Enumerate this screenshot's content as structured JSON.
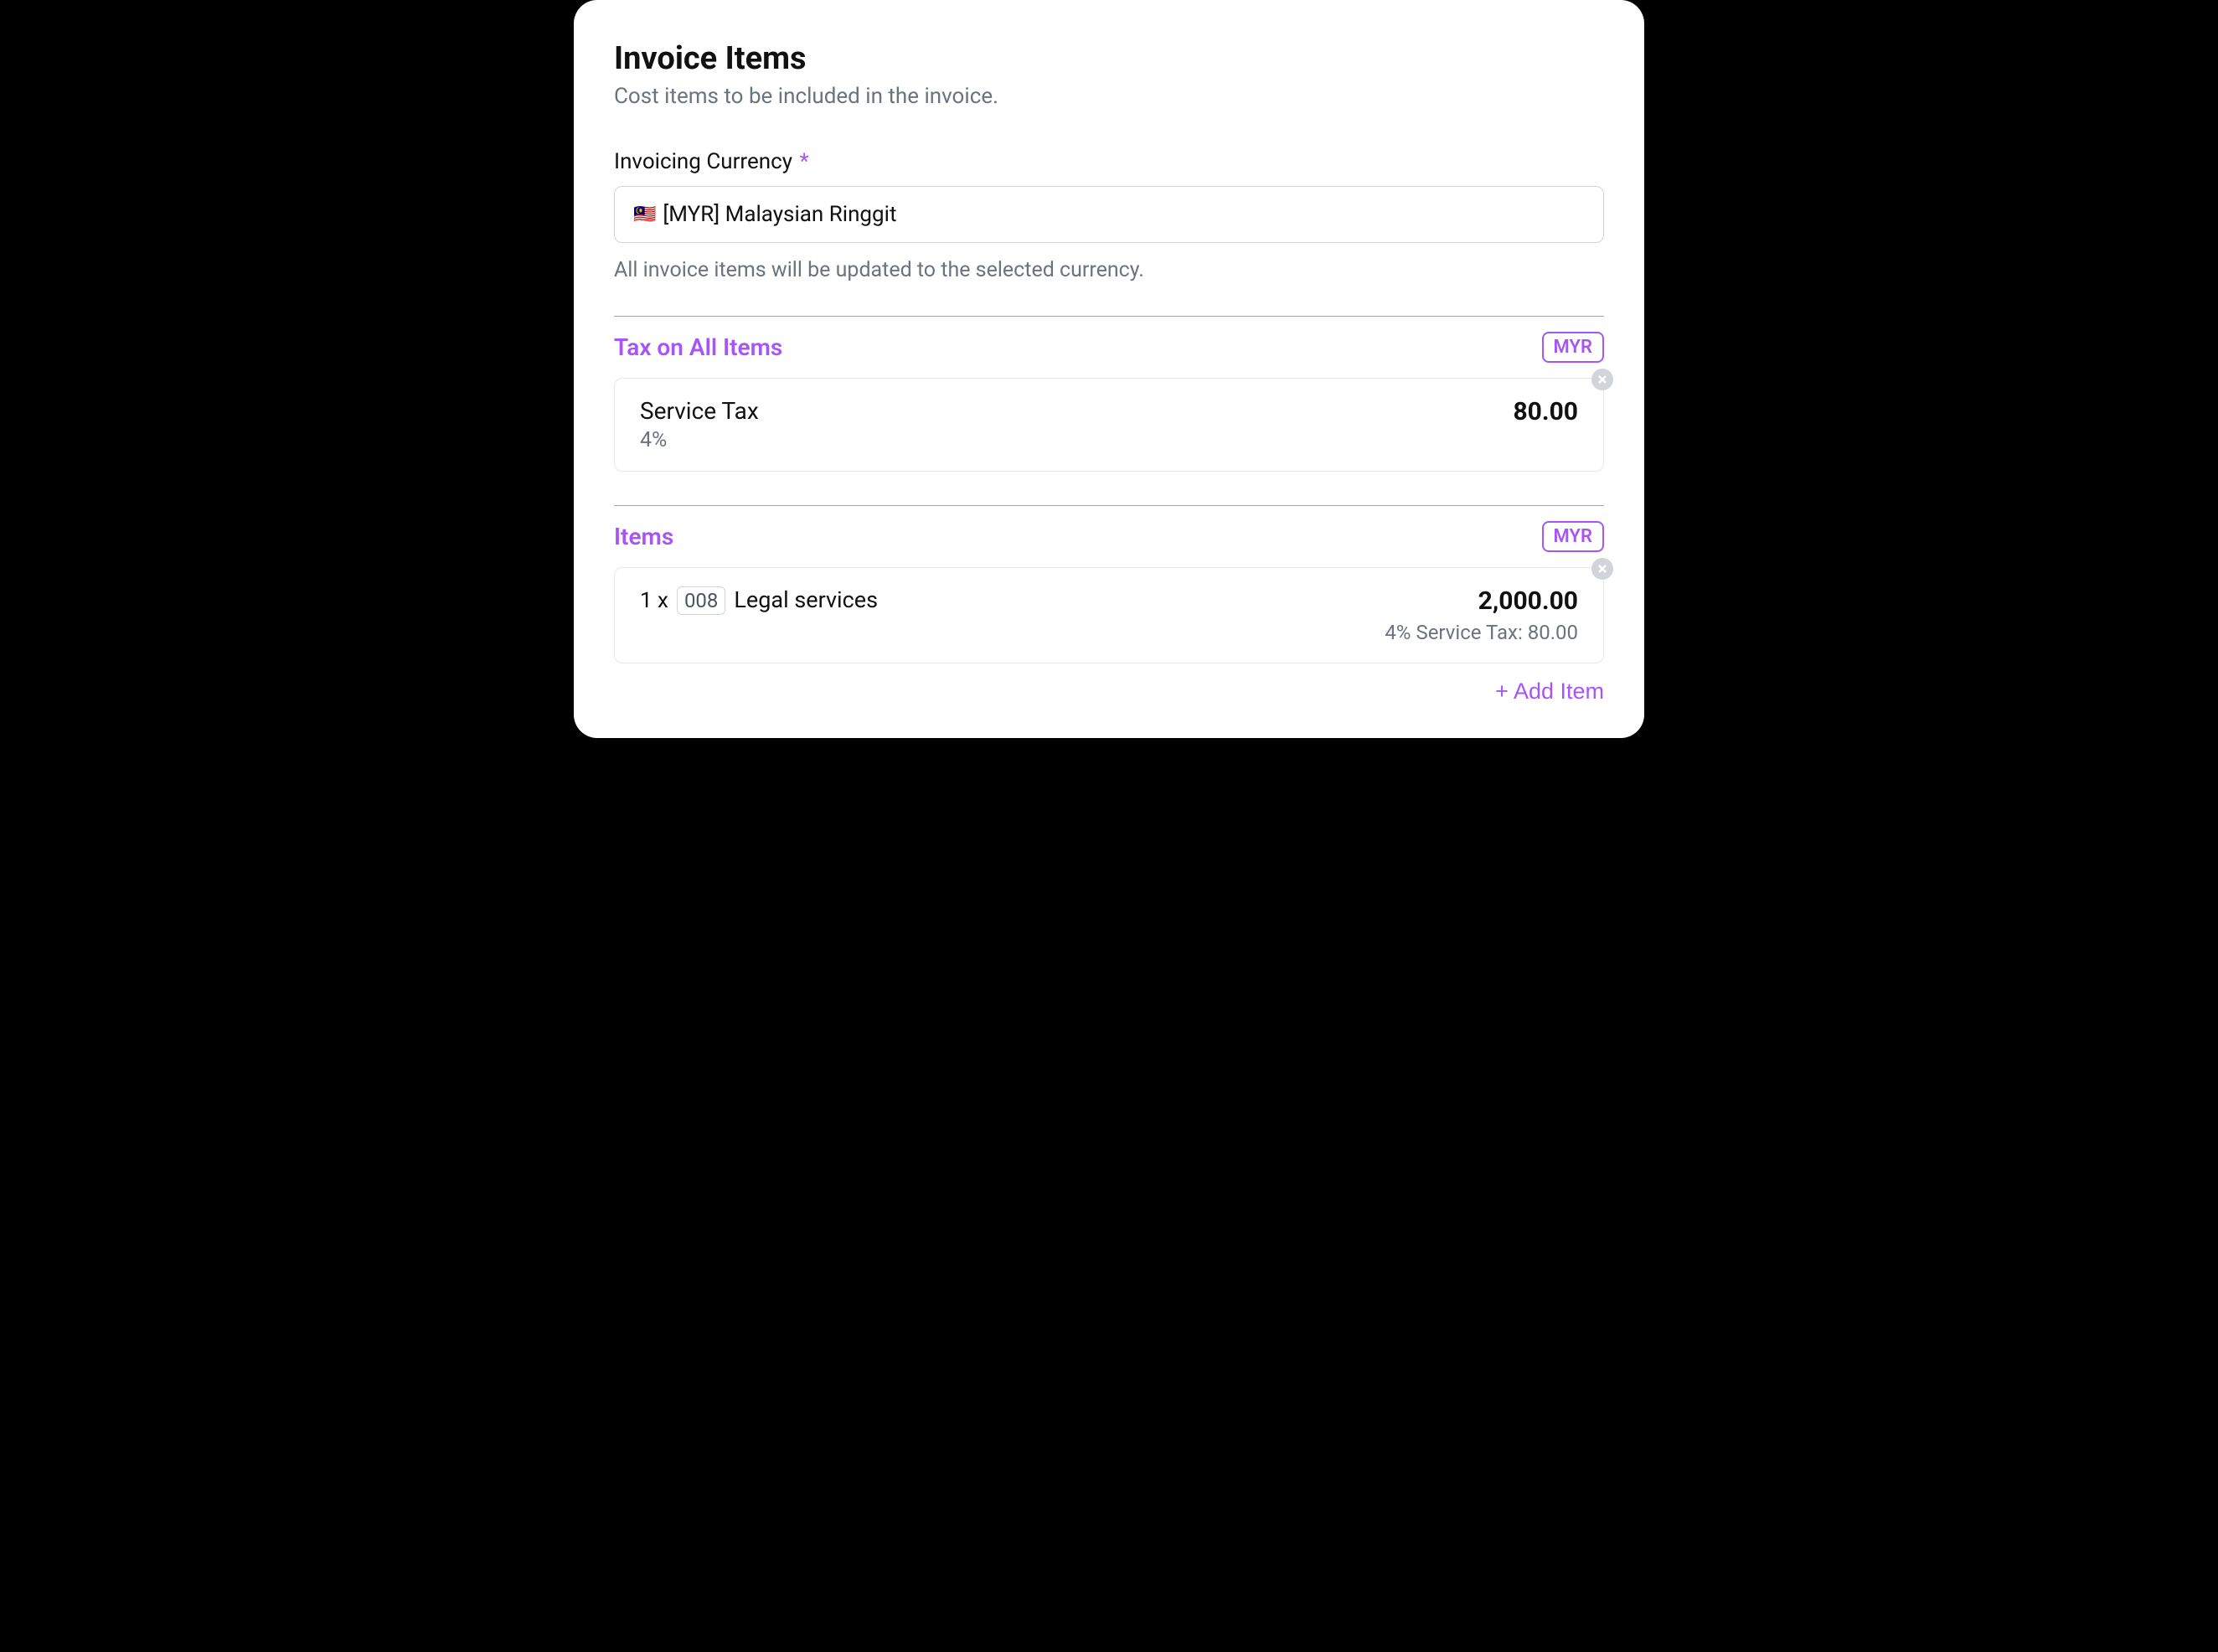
{
  "header": {
    "title": "Invoice Items",
    "subtitle": "Cost items to be included in the invoice."
  },
  "currency_field": {
    "label": "Invoicing Currency",
    "required_marker": "*",
    "flag": "🇲🇾",
    "value": "[MYR] Malaysian Ringgit",
    "help": "All invoice items will be updated to the selected currency."
  },
  "tax_section": {
    "title": "Tax on All Items",
    "currency_badge": "MYR",
    "tax": {
      "name": "Service Tax",
      "rate": "4%",
      "amount": "80.00"
    }
  },
  "items_section": {
    "title": "Items",
    "currency_badge": "MYR",
    "rows": [
      {
        "qty_prefix": "1 x",
        "code": "008",
        "description": "Legal services",
        "amount": "2,000.00",
        "tax_line": "4% Service Tax: 80.00"
      }
    ],
    "add_button": "Add Item"
  }
}
